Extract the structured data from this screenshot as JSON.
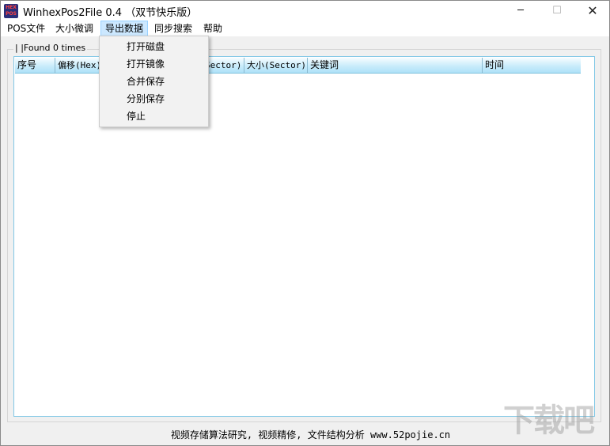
{
  "window": {
    "icon_text": "HEX POS",
    "title": "WinhexPos2File  0.4 （双节快乐版）",
    "minimize": "─",
    "maximize": "☐",
    "close": "✕"
  },
  "menubar": {
    "items": [
      {
        "label": "POS文件"
      },
      {
        "label": "大小微调"
      },
      {
        "label": "导出数据"
      },
      {
        "label": "同步搜索"
      },
      {
        "label": "帮助"
      }
    ]
  },
  "dropdown": {
    "items": [
      {
        "label": "打开磁盘"
      },
      {
        "label": "打开镜像"
      },
      {
        "label": "合并保存"
      },
      {
        "label": "分别保存"
      },
      {
        "label": "停止"
      }
    ]
  },
  "group": {
    "legend": "| |Found 0 times"
  },
  "list": {
    "columns": [
      {
        "label": "序号"
      },
      {
        "label": "偏移(Hex)"
      },
      {
        "label": "Sector)"
      },
      {
        "label": "大小(Sector)"
      },
      {
        "label": "关键词"
      },
      {
        "label": "时间"
      }
    ],
    "rows": []
  },
  "status": {
    "text": "视频存储算法研究, 视频精修, 文件结构分析 www.52pojie.cn"
  },
  "watermark": {
    "text": "下载吧"
  }
}
